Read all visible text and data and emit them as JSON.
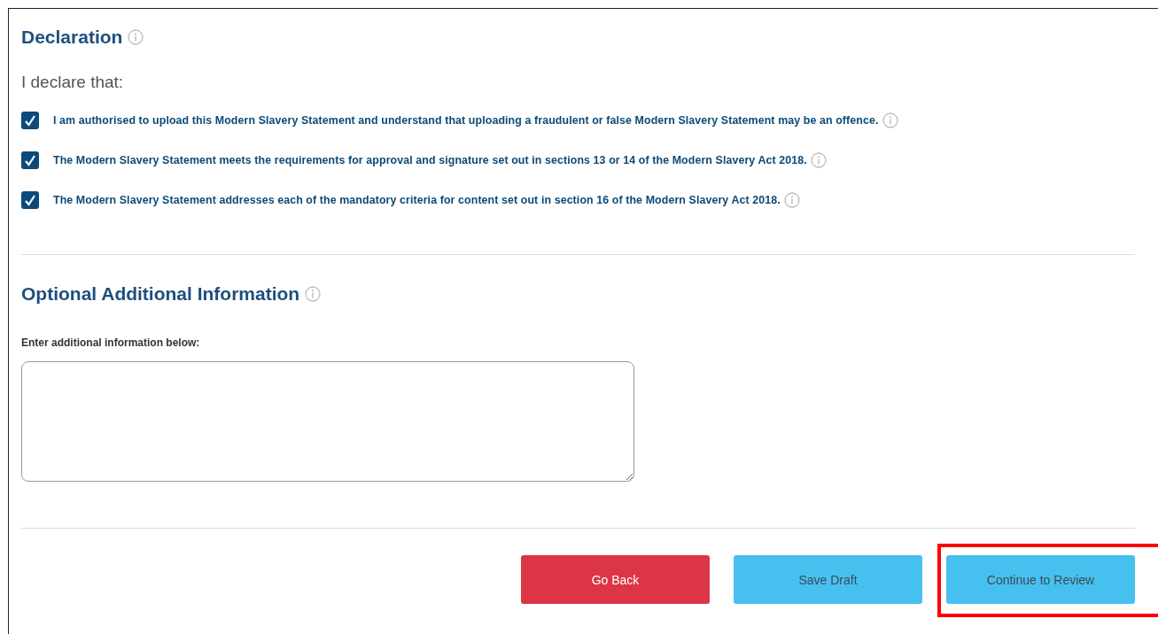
{
  "declaration": {
    "title": "Declaration",
    "intro": "I declare that:",
    "items": [
      {
        "label": "I am authorised to upload this Modern Slavery Statement and understand that uploading a fraudulent or false Modern Slavery Statement may be an offence.",
        "checked": true
      },
      {
        "label": "The Modern Slavery Statement meets the requirements for approval and signature set out in sections 13 or 14 of the Modern Slavery Act 2018.",
        "checked": true
      },
      {
        "label": "The Modern Slavery Statement addresses each of the mandatory criteria for content set out in section 16 of the Modern Slavery Act 2018.",
        "checked": true
      }
    ]
  },
  "additional": {
    "title": "Optional Additional Information",
    "field_label": "Enter additional information below:"
  },
  "buttons": [
    {
      "label": "Go Back",
      "kind": "danger",
      "highlighted": false
    },
    {
      "label": "Save Draft",
      "kind": "secondary",
      "highlighted": false
    },
    {
      "label": "Continue to Review",
      "kind": "secondary",
      "highlighted": true
    }
  ]
}
